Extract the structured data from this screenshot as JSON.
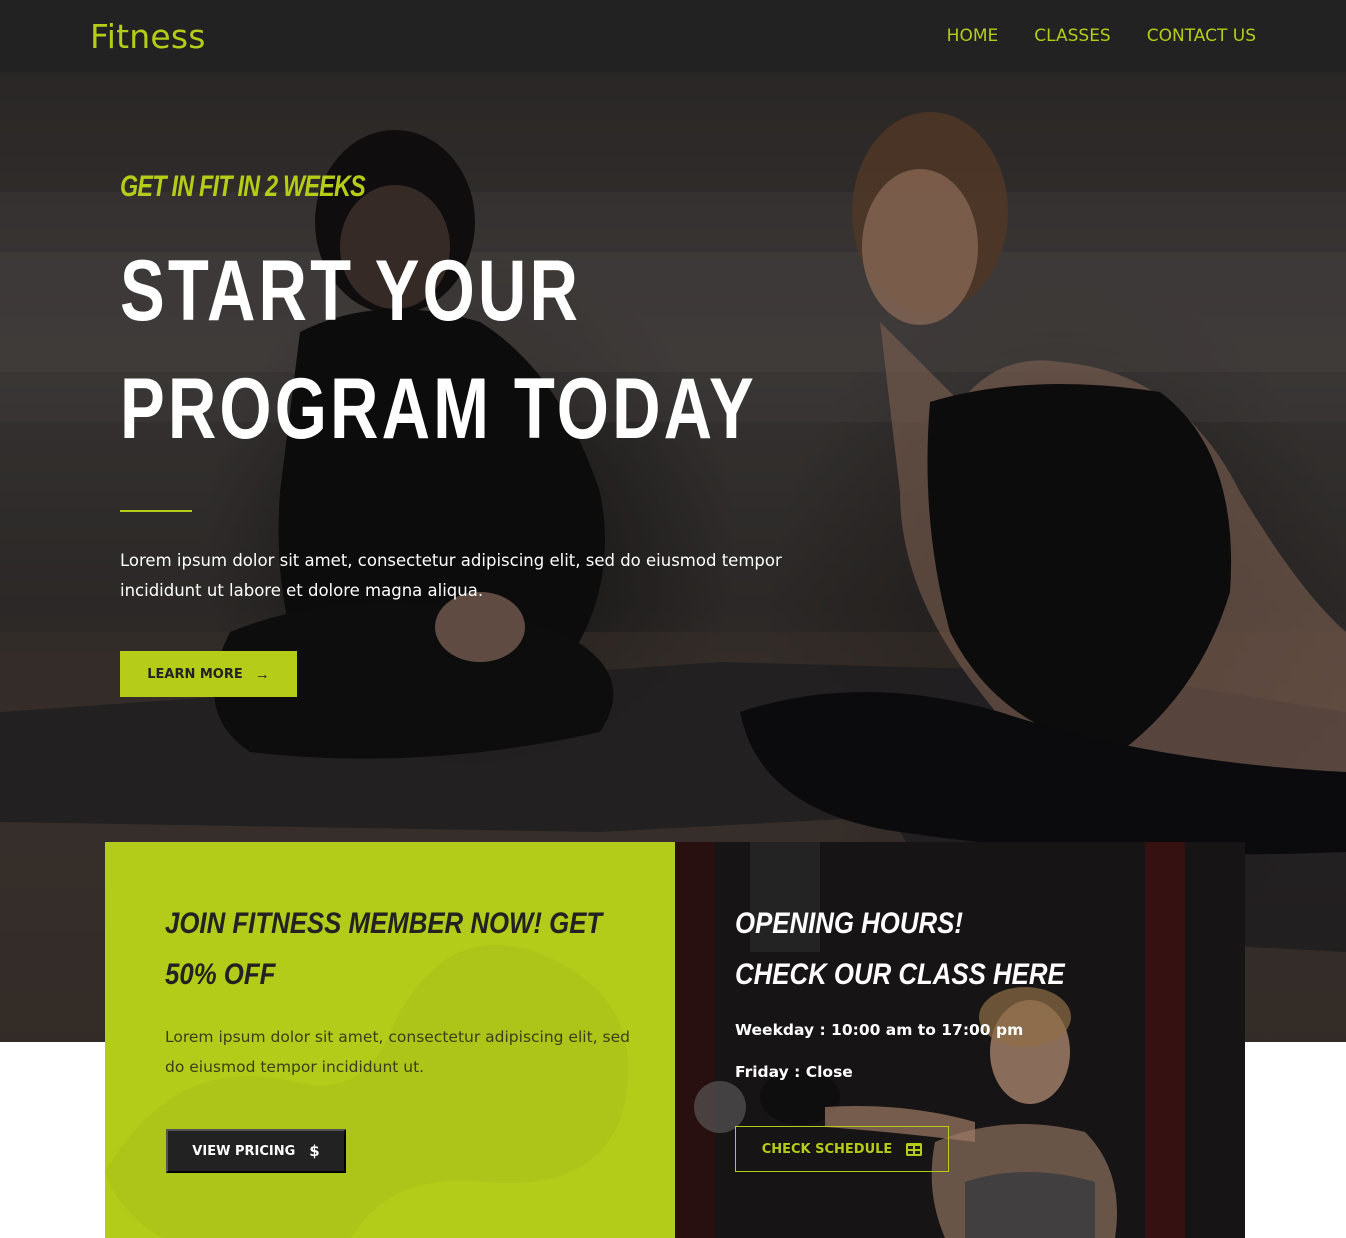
{
  "nav": {
    "brand": "Fitness",
    "links": [
      "HOME",
      "CLASSES",
      "CONTACT US"
    ]
  },
  "hero": {
    "tagline": "GET IN FIT IN 2 WEEKS",
    "title_line1": "START YOUR",
    "title_line2": "PROGRAM TODAY",
    "text": "Lorem ipsum dolor sit amet, consectetur adipiscing elit, sed do eiusmod tempor incididunt ut labore et dolore magna aliqua.",
    "button_label": "LEARN MORE",
    "button_icon": "arrow-right-icon"
  },
  "membership": {
    "title_line1": "JOIN FITNESS MEMBER NOW! GET",
    "title_line2": "50% OFF",
    "text": "Lorem ipsum dolor sit amet, consectetur adipiscing elit, sed do eiusmod tempor incididunt ut.",
    "button_label": "VIEW PRICING",
    "button_icon": "dollar-icon"
  },
  "hours": {
    "title_line1": "OPENING HOURS!",
    "title_line2": "CHECK OUR CLASS HERE",
    "weekday": "Weekday : 10:00 am to 17:00 pm",
    "friday": "Friday : Close",
    "button_label": "CHECK SCHEDULE",
    "button_icon": "calendar-icon"
  },
  "colors": {
    "accent": "#b5cc18",
    "dark": "#222222",
    "white": "#ffffff"
  }
}
